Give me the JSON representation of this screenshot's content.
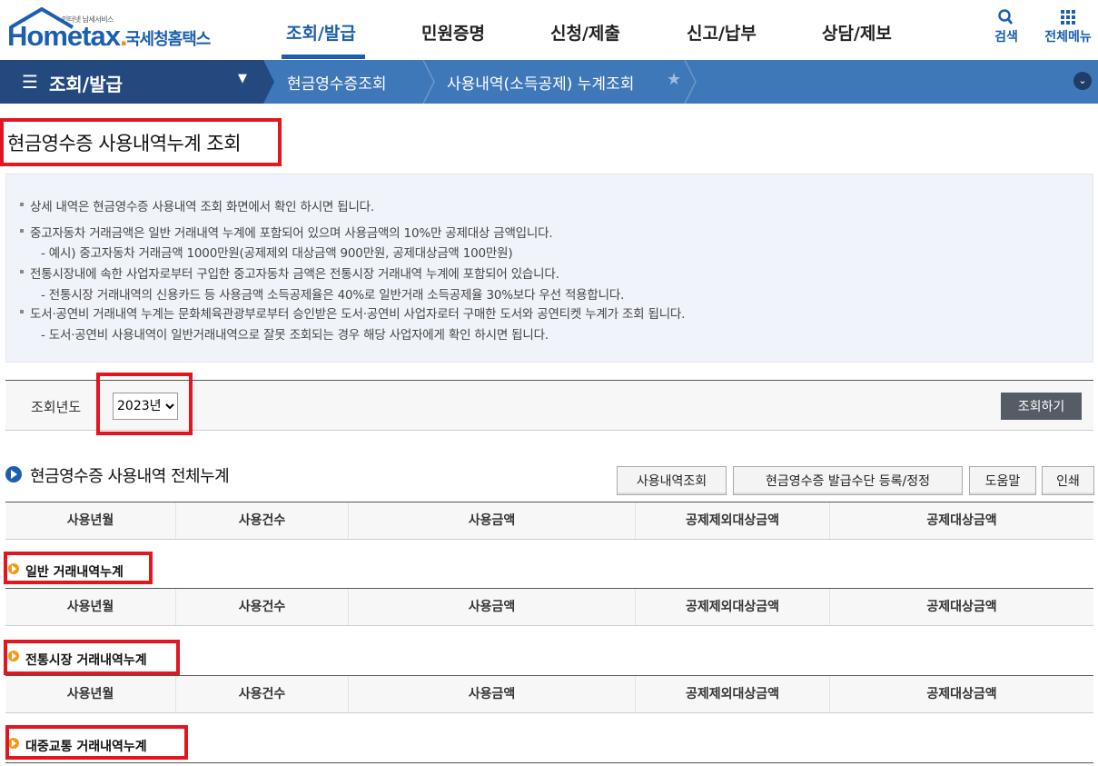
{
  "header": {
    "logo_sub": "인터넷 납세서비스",
    "logo_main_a": "Hom",
    "logo_main_b": "etax",
    "logo_main_dot": ".",
    "logo_kr": "국세청홈택스",
    "nav": [
      "조회/발급",
      "민원증명",
      "신청/제출",
      "신고/납부",
      "상담/제보"
    ],
    "search_label": "검색",
    "all_menu_label": "전체메뉴"
  },
  "subnav": {
    "menu_label": "조회/발급",
    "crumbs": [
      "현금영수증조회",
      "사용내역(소득공제) 누계조회"
    ]
  },
  "page": {
    "title": "현금영수증 사용내역누계 조회"
  },
  "info": {
    "lines": [
      "상세 내역은 현금영수증 사용내역 조회 화면에서 확인 하시면 됩니다.",
      "중고자동차 거래금액은 일반 거래내역 누계에 포함되어 있으며 사용금액의 10%만 공제대상 금액입니다.",
      "- 예시) 중고자동차 거래금액 1000만원(공제제외 대상금액 900만원, 공제대상금액 100만원)",
      "전통시장내에 속한 사업자로부터 구입한 중고자동차 금액은 전통시장 거래내역 누계에 포함되어 있습니다.",
      "- 전통시장 거래내역의 신용카드 등 사용금액 소득공제율은 40%로 일반거래 소득공제율 30%보다 우선 적용합니다.",
      "도서·공연비 거래내역 누계는 문화체육관광부로부터 승인받은 도서·공연비 사업자로터 구매한 도서와 공연티켓 누계가 조회 됩니다.",
      "- 도서·공연비 사용내역이 일반거래내역으로 잘못 조회되는 경우 해당 사업자에게 확인 하시면 됩니다."
    ]
  },
  "search": {
    "year_label": "조회년도",
    "year_value": "2023년",
    "submit_label": "조회하기"
  },
  "section": {
    "title": "현금영수증 사용내역 전체누계",
    "buttons": [
      "사용내역조회",
      "현금영수증 발급수단 등록/정정",
      "도움말",
      "인쇄"
    ]
  },
  "table": {
    "columns": [
      "사용년월",
      "사용건수",
      "사용금액",
      "공제제외대상금액",
      "공제대상금액"
    ]
  },
  "subsections": [
    "일반 거래내역누계",
    "전통시장 거래내역누계",
    "대중교통 거래내역누계"
  ],
  "colors": {
    "brand_blue": "#1b5fae",
    "subnav_blue": "#3f78b8",
    "subnav_dark": "#23497e",
    "highlight_red": "#e3151f"
  }
}
